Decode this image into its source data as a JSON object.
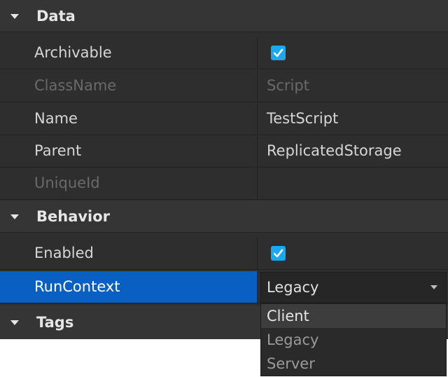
{
  "sections": {
    "data": {
      "title": "Data"
    },
    "behavior": {
      "title": "Behavior"
    },
    "tags": {
      "title": "Tags"
    }
  },
  "properties": {
    "archivable": {
      "name": "Archivable",
      "checked": true
    },
    "classname": {
      "name": "ClassName",
      "value": "Script"
    },
    "name": {
      "name": "Name",
      "value": "TestScript"
    },
    "parent": {
      "name": "Parent",
      "value": "ReplicatedStorage"
    },
    "uniqueid": {
      "name": "UniqueId",
      "value": ""
    },
    "enabled": {
      "name": "Enabled",
      "checked": true
    },
    "runcontext": {
      "name": "RunContext",
      "value": "Legacy"
    }
  },
  "runcontext_menu": {
    "options": [
      "Client",
      "Legacy",
      "Server"
    ],
    "hovered": "Client"
  },
  "icons": {
    "section_toggle": "caret-down-icon",
    "checkbox": "checkmark-icon",
    "dropdown": "chevron-down-icon"
  },
  "colors": {
    "panel_bg": "#2e2e2e",
    "section_bg": "#353535",
    "selected_row": "#0a5fc2",
    "checkbox": "#1aa8f0",
    "disabled_text": "#6a6a6a"
  }
}
